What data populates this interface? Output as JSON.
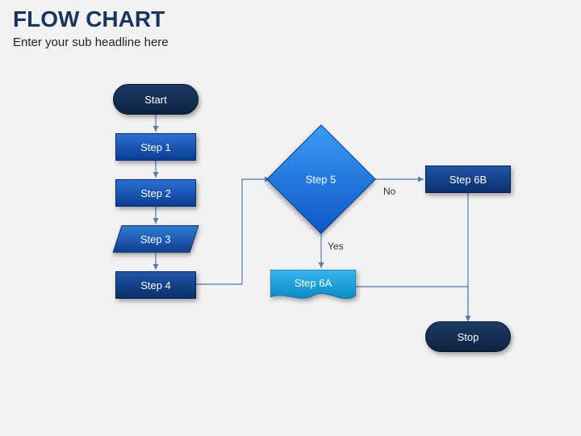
{
  "header": {
    "title": "FLOW CHART",
    "subtitle": "Enter your sub headline here"
  },
  "nodes": {
    "start": "Start",
    "step1": "Step 1",
    "step2": "Step 2",
    "step3": "Step 3",
    "step4": "Step 4",
    "step5": "Step 5",
    "step6a": "Step 6A",
    "step6b": "Step 6B",
    "stop": "Stop"
  },
  "edges": {
    "yes": "Yes",
    "no": "No"
  }
}
